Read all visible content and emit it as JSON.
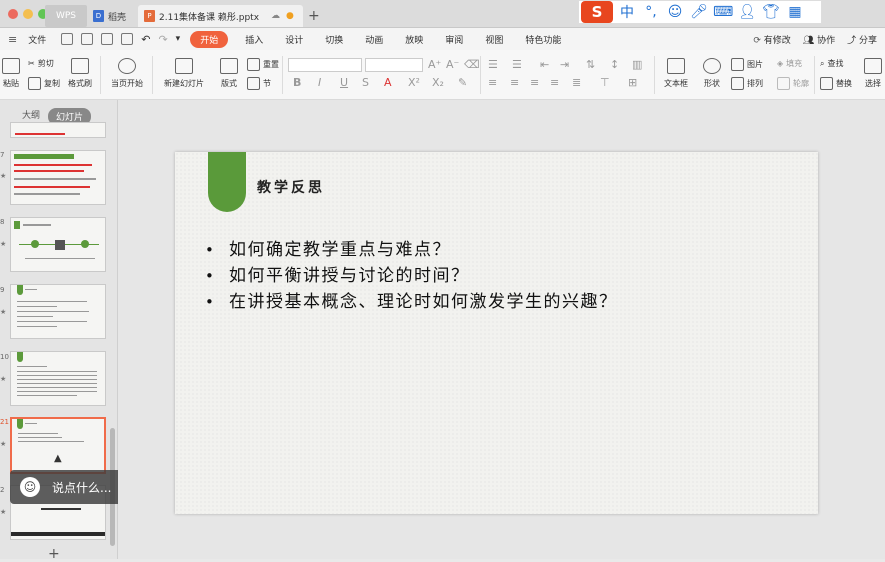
{
  "titlebar": {
    "tabs": [
      {
        "label": "WPS"
      },
      {
        "label": "稻壳"
      },
      {
        "label": "2.11集体备课 赖彤.pptx"
      }
    ],
    "new_tab": "+",
    "ime": {
      "logo": "S",
      "mode": "中"
    }
  },
  "menubar": {
    "file": "文件",
    "items": [
      "开始",
      "插入",
      "设计",
      "切换",
      "动画",
      "放映",
      "审阅",
      "视图",
      "特色功能"
    ],
    "right": [
      "有修改",
      "协作",
      "分享"
    ]
  },
  "ribbon": {
    "paste": "粘贴",
    "cut": "剪切",
    "copy": "复制",
    "format_painter": "格式刷",
    "play_from_current": "当页开始",
    "new_slide": "新建幻灯片",
    "layout": "版式",
    "section": "节",
    "reset": "重置",
    "textbox": "文本框",
    "shape": "形状",
    "picture": "图片",
    "fill": "填充",
    "arrange": "排列",
    "outline": "轮廓",
    "find": "查找",
    "replace": "替换",
    "select": "选择"
  },
  "leftpanel": {
    "outline_tab": "大纲",
    "slides_tab": "幻灯片",
    "slide_numbers": [
      "7",
      "8",
      "9",
      "10",
      "21",
      "2"
    ],
    "add_slide": "+"
  },
  "chat": {
    "placeholder": "说点什么...",
    "collapse": "‹"
  },
  "slide": {
    "title": "教学反思",
    "bullets": [
      "如何确定教学重点与难点？",
      "如何平衡讲授与讨论的时间？",
      "在讲授基本概念、理论时如何激发学生的兴趣？"
    ]
  },
  "colors": {
    "accent_orange": "#f0623d",
    "banner_green": "#5a9a3a",
    "ime_red": "#e8461e"
  }
}
